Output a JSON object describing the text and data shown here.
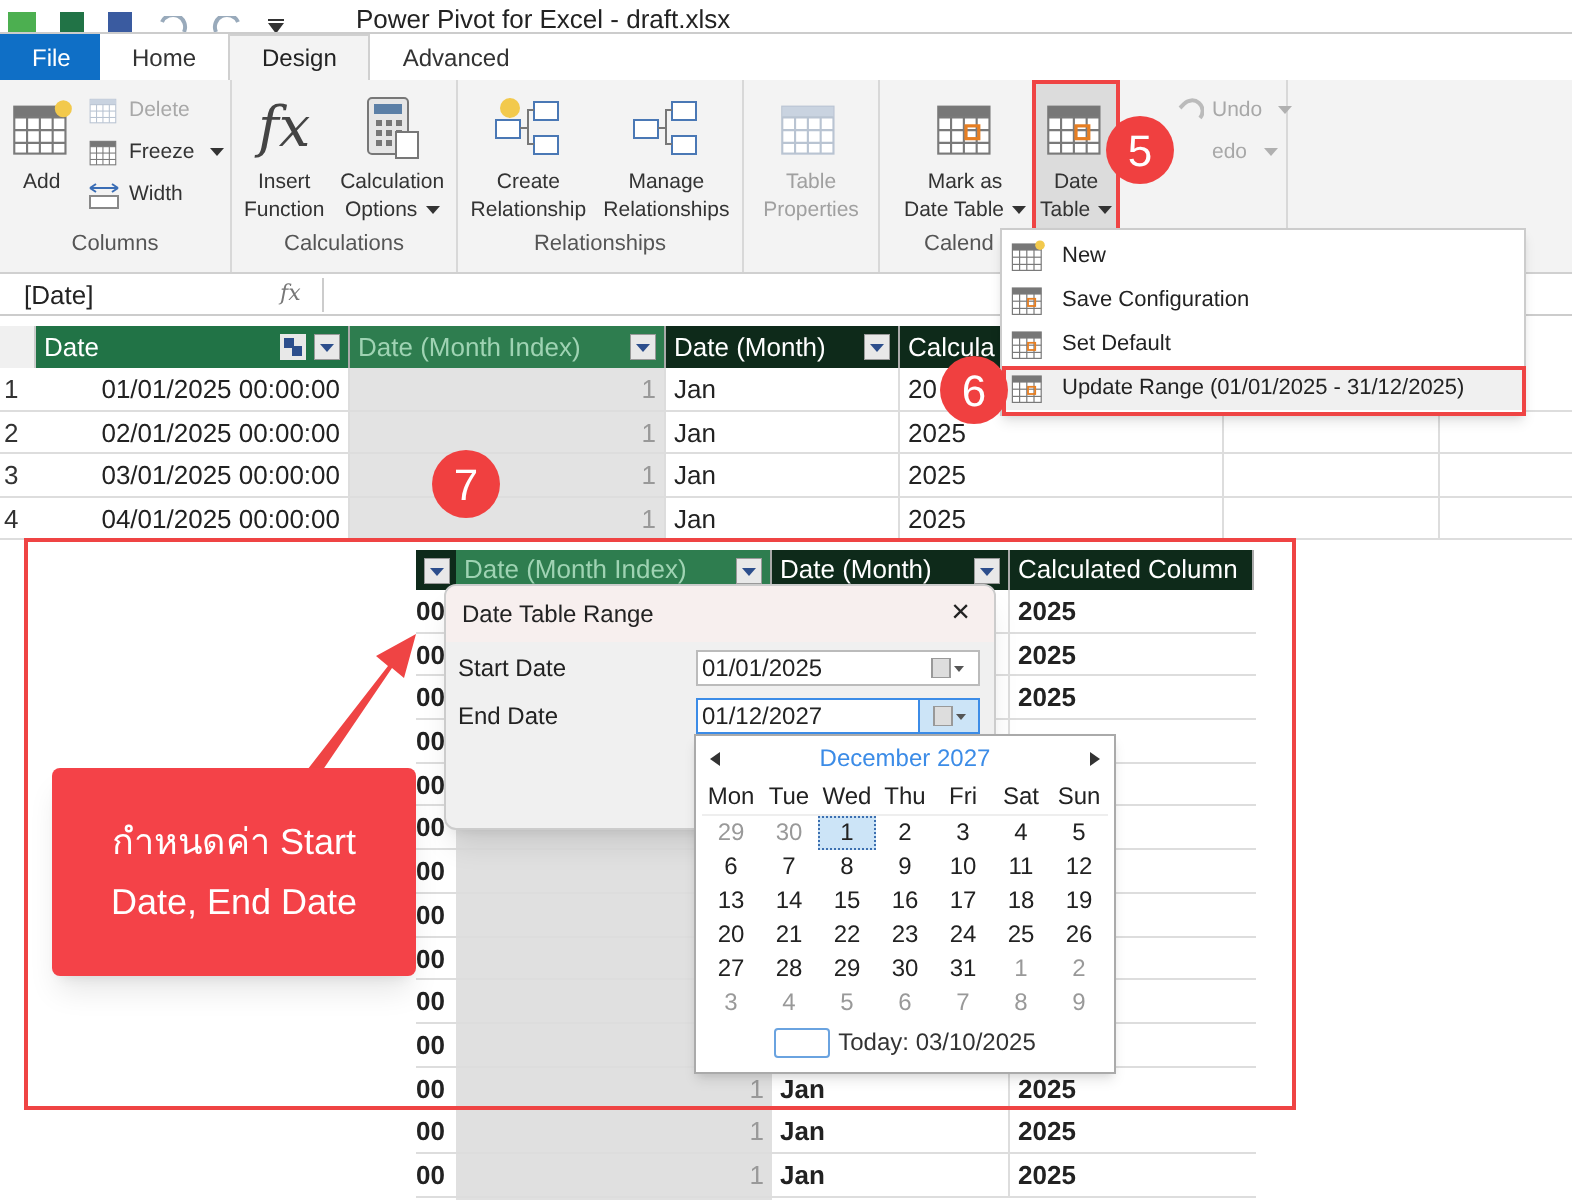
{
  "title_bar": {
    "title": "Power Pivot for Excel - draft.xlsx"
  },
  "tabs": [
    {
      "label": "File",
      "kind": "file",
      "selected": false
    },
    {
      "label": "Home",
      "kind": "tab",
      "selected": false
    },
    {
      "label": "Design",
      "kind": "tab",
      "selected": true
    },
    {
      "label": "Advanced",
      "kind": "tab",
      "selected": false
    }
  ],
  "ribbon": {
    "groups": [
      {
        "label": "Columns",
        "large": [
          {
            "lines": [
              "Add"
            ],
            "dropdown": false,
            "disabled": false,
            "pressed": false
          }
        ],
        "small": [
          {
            "label": "Delete",
            "dropdown": false,
            "disabled": true
          },
          {
            "label": "Freeze",
            "dropdown": true,
            "disabled": false
          },
          {
            "label": "Width",
            "dropdown": false,
            "disabled": false
          }
        ]
      },
      {
        "label": "Calculations",
        "large": [
          {
            "lines": [
              "Insert",
              "Function"
            ],
            "glyph": "fx",
            "dropdown": false,
            "disabled": false,
            "pressed": false
          },
          {
            "lines": [
              "Calculation",
              "Options"
            ],
            "dropdown": true,
            "disabled": false,
            "pressed": false
          }
        ]
      },
      {
        "label": "Relationships",
        "large": [
          {
            "lines": [
              "Create",
              "Relationship"
            ],
            "dropdown": false,
            "disabled": false,
            "pressed": false
          },
          {
            "lines": [
              "Manage",
              "Relationships"
            ],
            "dropdown": false,
            "disabled": false,
            "pressed": false
          }
        ]
      },
      {
        "large": [
          {
            "lines": [
              "Table",
              "Properties"
            ],
            "dropdown": false,
            "disabled": true,
            "pressed": false
          }
        ]
      },
      {
        "label": "Calend",
        "large": [
          {
            "lines": [
              "Mark as",
              "Date Table"
            ],
            "dropdown": true,
            "disabled": false,
            "pressed": false
          },
          {
            "lines": [
              "Date",
              "Table"
            ],
            "dropdown": true,
            "disabled": false,
            "pressed": true
          }
        ]
      },
      {
        "small": [
          {
            "label": "Undo",
            "dropdown": true,
            "disabled": true
          },
          {
            "label": "edo",
            "dropdown": true,
            "disabled": true
          }
        ]
      }
    ]
  },
  "formula_bar": {
    "name_box": "[Date]",
    "formula_symbol": "fx"
  },
  "table": {
    "columns": [
      {
        "label": "Date",
        "kind": "key"
      },
      {
        "label": "Date (Month Index)",
        "kind": "computed"
      },
      {
        "label": "Date (Month)",
        "kind": "dark"
      },
      {
        "label": "Calcula",
        "kind": "dark"
      }
    ],
    "rows": [
      {
        "number": "1",
        "cells": [
          "01/01/2025 00:00:00",
          "1",
          "Jan",
          "20"
        ]
      },
      {
        "number": "2",
        "cells": [
          "02/01/2025 00:00:00",
          "1",
          "Jan",
          "2025"
        ]
      },
      {
        "number": "3",
        "cells": [
          "03/01/2025 00:00:00",
          "1",
          "Jan",
          "2025"
        ]
      },
      {
        "number": "4",
        "cells": [
          "04/01/2025 00:00:00",
          "1",
          "Jan",
          "2025"
        ]
      }
    ]
  },
  "date_table_menu": {
    "items": [
      {
        "label": "New",
        "selected": false
      },
      {
        "label": "Save Configuration",
        "selected": false
      },
      {
        "label": "Set Default",
        "selected": false
      },
      {
        "label": "Update Range (01/01/2025 - 31/12/2025)",
        "selected": true
      }
    ]
  },
  "inset": {
    "columns": [
      {
        "label": "Date (Month Index)",
        "kind": "computed"
      },
      {
        "label": "Date (Month)",
        "kind": "dark"
      },
      {
        "label": "Calculated Column",
        "kind": "dark"
      }
    ],
    "rows": [
      {
        "date": "00",
        "year": "2025"
      },
      {
        "date": "00",
        "year": "2025"
      },
      {
        "date": "00",
        "year": "2025"
      },
      {
        "date": "00"
      },
      {
        "date": "00"
      },
      {
        "date": "00"
      },
      {
        "date": "00"
      },
      {
        "date": "00"
      },
      {
        "date": "00"
      },
      {
        "date": "00"
      },
      {
        "date": "00"
      },
      {
        "date": "00",
        "index": "1",
        "month": "Jan",
        "year": "2025"
      },
      {
        "date": "00",
        "index": "1",
        "month": "Jan",
        "year": "2025"
      },
      {
        "date": "00",
        "index": "1",
        "month": "Jan",
        "year": "2025"
      }
    ]
  },
  "dialog": {
    "title": "Date Table Range",
    "close": "×",
    "fields": [
      {
        "label": "Start Date",
        "value": "01/01/2025",
        "active": false
      },
      {
        "label": "End Date",
        "value": "01/12/2027",
        "active": true
      }
    ]
  },
  "calendar": {
    "month": "December 2027",
    "weekdays": [
      "Mon",
      "Tue",
      "Wed",
      "Thu",
      "Fri",
      "Sat",
      "Sun"
    ],
    "weeks": [
      [
        {
          "day": "29",
          "kind": "other"
        },
        {
          "day": "30",
          "kind": "other"
        },
        {
          "day": "1",
          "kind": "selected"
        },
        {
          "day": "2",
          "kind": "day"
        },
        {
          "day": "3",
          "kind": "day"
        },
        {
          "day": "4",
          "kind": "day"
        },
        {
          "day": "5",
          "kind": "day"
        }
      ],
      [
        {
          "day": "6",
          "kind": "day"
        },
        {
          "day": "7",
          "kind": "day"
        },
        {
          "day": "8",
          "kind": "day"
        },
        {
          "day": "9",
          "kind": "day"
        },
        {
          "day": "10",
          "kind": "day"
        },
        {
          "day": "11",
          "kind": "day"
        },
        {
          "day": "12",
          "kind": "day"
        }
      ],
      [
        {
          "day": "13",
          "kind": "day"
        },
        {
          "day": "14",
          "kind": "day"
        },
        {
          "day": "15",
          "kind": "day"
        },
        {
          "day": "16",
          "kind": "day"
        },
        {
          "day": "17",
          "kind": "day"
        },
        {
          "day": "18",
          "kind": "day"
        },
        {
          "day": "19",
          "kind": "day"
        }
      ],
      [
        {
          "day": "20",
          "kind": "day"
        },
        {
          "day": "21",
          "kind": "day"
        },
        {
          "day": "22",
          "kind": "day"
        },
        {
          "day": "23",
          "kind": "day"
        },
        {
          "day": "24",
          "kind": "day"
        },
        {
          "day": "25",
          "kind": "day"
        },
        {
          "day": "26",
          "kind": "day"
        }
      ],
      [
        {
          "day": "27",
          "kind": "day"
        },
        {
          "day": "28",
          "kind": "day"
        },
        {
          "day": "29",
          "kind": "day"
        },
        {
          "day": "30",
          "kind": "day"
        },
        {
          "day": "31",
          "kind": "day"
        },
        {
          "day": "1",
          "kind": "other"
        },
        {
          "day": "2",
          "kind": "other"
        }
      ],
      [
        {
          "day": "3",
          "kind": "other"
        },
        {
          "day": "4",
          "kind": "other"
        },
        {
          "day": "5",
          "kind": "other"
        },
        {
          "day": "6",
          "kind": "other"
        },
        {
          "day": "7",
          "kind": "other"
        },
        {
          "day": "8",
          "kind": "other"
        },
        {
          "day": "9",
          "kind": "other"
        }
      ]
    ],
    "today": "Today: 03/10/2025"
  },
  "annotations": {
    "steps": [
      "5",
      "6",
      "7"
    ],
    "callout": "กำหนดค่า Start Date, End Date"
  }
}
